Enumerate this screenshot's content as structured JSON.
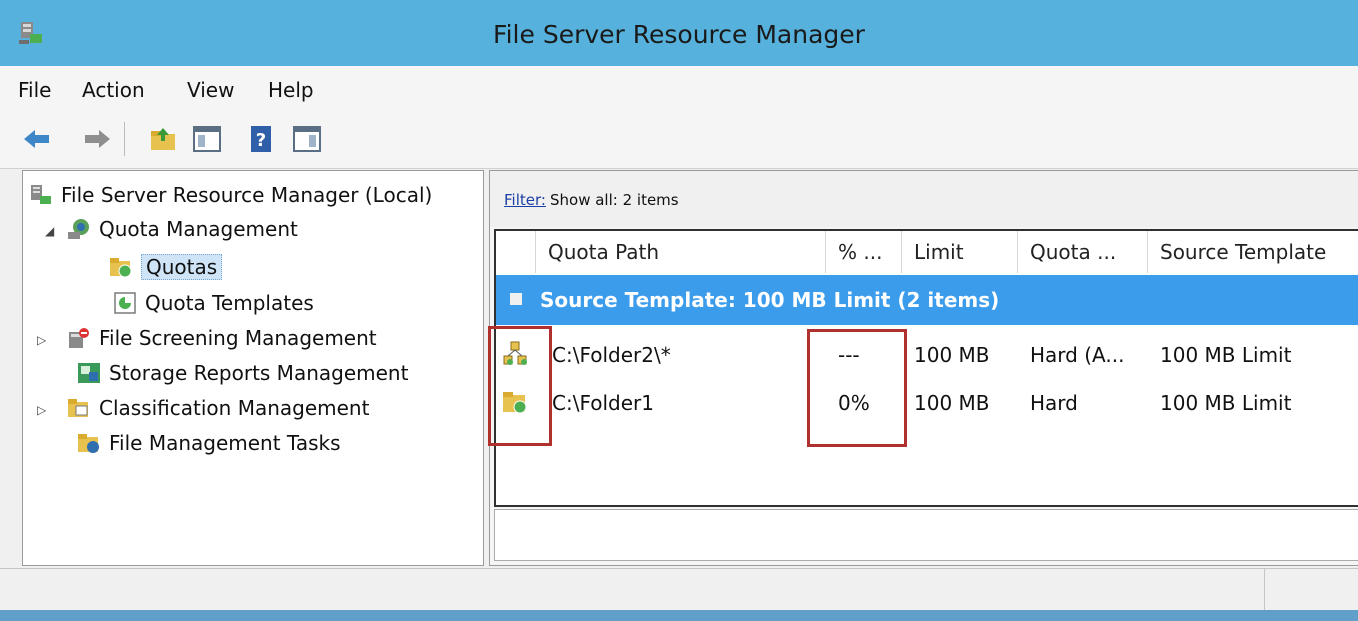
{
  "window": {
    "title": "File Server Resource Manager"
  },
  "menu": [
    "File",
    "Action",
    "View",
    "Help"
  ],
  "toolbar": {
    "buttons": [
      "back-arrow-icon",
      "forward-arrow-icon",
      "up-folder-icon",
      "show-hide-console-tree-icon",
      "help-icon",
      "show-hide-action-pane-icon"
    ]
  },
  "tree": {
    "root": "File Server Resource Manager (Local)",
    "quota_management": "Quota Management",
    "quotas": "Quotas",
    "quota_templates": "Quota Templates",
    "file_screening": "File Screening Management",
    "storage_reports": "Storage Reports Management",
    "classification": "Classification Management",
    "file_management_tasks": "File Management Tasks"
  },
  "filter": {
    "link": "Filter:",
    "text": "Show all: 2 items"
  },
  "columns": [
    "Quota Path",
    "% ...",
    "Limit",
    "Quota ...",
    "Source Template"
  ],
  "group": {
    "label": "Source Template: 100 MB Limit (2 items)"
  },
  "rows": [
    {
      "icon": "auto-apply-quota-icon",
      "path": "C:\\Folder2\\*",
      "pct": "---",
      "limit": "100 MB",
      "quota_type": "Hard (A...",
      "template": "100 MB Limit"
    },
    {
      "icon": "quota-folder-icon",
      "path": "C:\\Folder1",
      "pct": "0%",
      "limit": "100 MB",
      "quota_type": "Hard",
      "template": "100 MB Limit"
    }
  ],
  "colors": {
    "title_bar": "#56b2dc",
    "group_header": "#3c9cec",
    "highlight_box": "#b0302e"
  }
}
